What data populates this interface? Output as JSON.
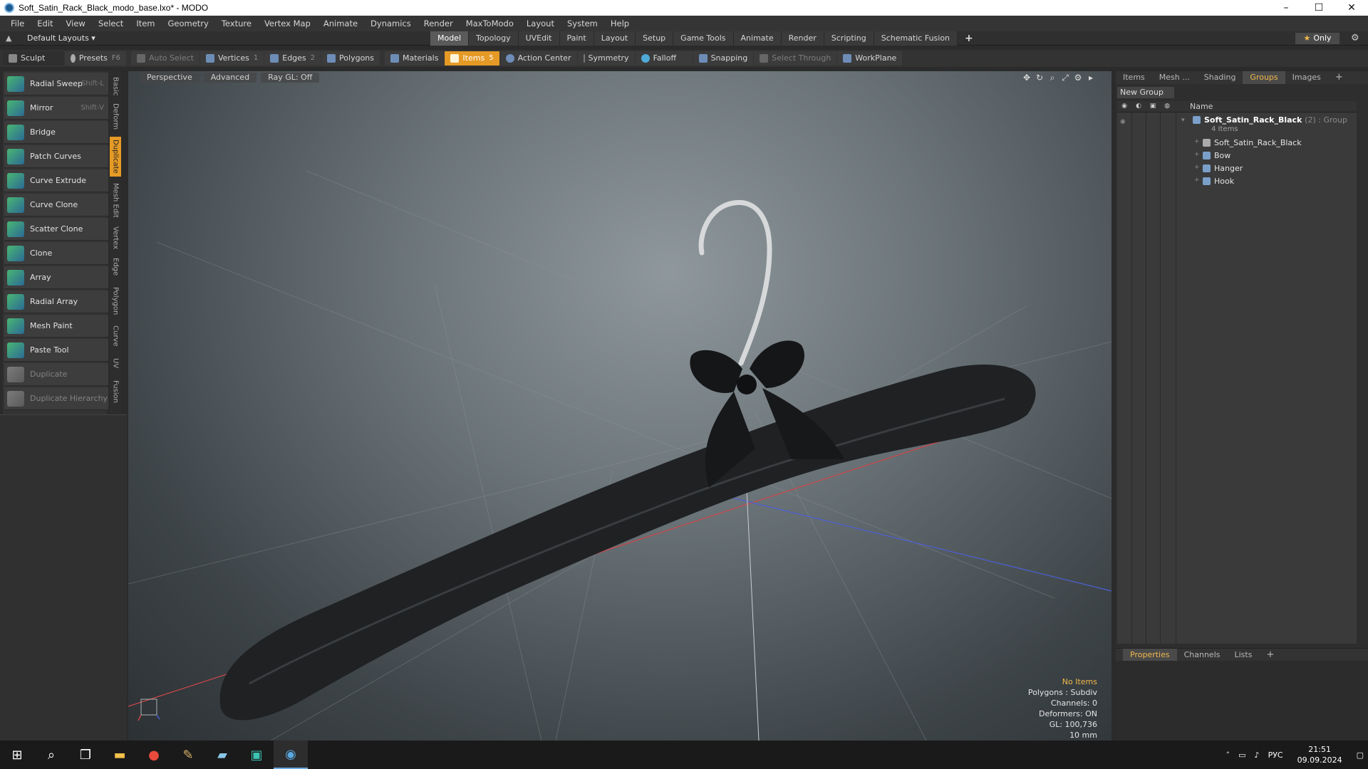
{
  "window": {
    "title": "Soft_Satin_Rack_Black_modo_base.lxo* - MODO",
    "minimize": "–",
    "maximize": "☐",
    "close": "✕"
  },
  "menu": [
    "File",
    "Edit",
    "View",
    "Select",
    "Item",
    "Geometry",
    "Texture",
    "Vertex Map",
    "Animate",
    "Dynamics",
    "Render",
    "MaxToModo",
    "Layout",
    "System",
    "Help"
  ],
  "layoutbar": {
    "default_layouts": "Default Layouts ▾",
    "tabs": [
      "Model",
      "Topology",
      "UVEdit",
      "Paint",
      "Layout",
      "Setup",
      "Game Tools",
      "Animate",
      "Render",
      "Scripting",
      "Schematic Fusion"
    ],
    "active_tab": "Model",
    "add": "+",
    "only": "Only",
    "star": "★",
    "gear": "⚙"
  },
  "toolbar": {
    "sculpt": "Sculpt",
    "presets": "Presets",
    "presets_key": "F6",
    "auto_select": "Auto Select",
    "vertices": "Vertices",
    "vertices_count": "1",
    "edges": "Edges",
    "edges_count": "2",
    "polygons": "Polygons",
    "materials": "Materials",
    "items": "Items",
    "items_count": "5",
    "action_center": "Action Center",
    "symmetry": "Symmetry",
    "falloff": "Falloff",
    "snapping": "Snapping",
    "select_through": "Select Through",
    "workplane": "WorkPlane"
  },
  "tools": [
    {
      "label": "Radial Sweep",
      "key": "Shift-L",
      "enabled": true
    },
    {
      "label": "Mirror",
      "key": "Shift-V",
      "enabled": true
    },
    {
      "label": "Bridge",
      "key": "",
      "enabled": true
    },
    {
      "label": "Patch Curves",
      "key": "",
      "enabled": true
    },
    {
      "label": "Curve Extrude",
      "key": "",
      "enabled": true
    },
    {
      "label": "Curve Clone",
      "key": "",
      "enabled": true
    },
    {
      "label": "Scatter Clone",
      "key": "",
      "enabled": true
    },
    {
      "label": "Clone",
      "key": "",
      "enabled": true
    },
    {
      "label": "Array",
      "key": "",
      "enabled": true
    },
    {
      "label": "Radial Array",
      "key": "",
      "enabled": true
    },
    {
      "label": "Mesh Paint",
      "key": "",
      "enabled": true
    },
    {
      "label": "Paste Tool",
      "key": "",
      "enabled": true
    },
    {
      "label": "Duplicate",
      "key": "",
      "enabled": false
    },
    {
      "label": "Duplicate Hierarchy",
      "key": "",
      "enabled": false
    }
  ],
  "side_tabs": [
    "Basic",
    "Deform",
    "Duplicate",
    "Mesh Edit",
    "Vertex",
    "Edge",
    "Polygon",
    "Curve",
    "UV",
    "Fusion"
  ],
  "active_side_tab": "Duplicate",
  "viewport": {
    "tabs": [
      "Perspective",
      "Advanced",
      "Ray GL: Off"
    ],
    "icons": [
      "move-icon",
      "rotate-icon",
      "zoom-icon",
      "fit-icon",
      "settings-icon",
      "expand-icon"
    ],
    "info": {
      "no_items": "No Items",
      "polygons": "Polygons : Subdiv",
      "channels": "Channels: 0",
      "deformers": "Deformers: ON",
      "gl": "GL: 100,736",
      "scale": "10 mm"
    }
  },
  "right_panel": {
    "tabs": [
      "Items",
      "Mesh ...",
      "Shading",
      "Groups",
      "Images"
    ],
    "active_tab": "Groups",
    "add": "+",
    "new_group": "New Group",
    "name_header": "Name",
    "group": {
      "name": "Soft_Satin_Rack_Black",
      "suffix": "(2) : Group",
      "count": "4 Items"
    },
    "children": [
      "Soft_Satin_Rack_Black",
      "Bow",
      "Hanger",
      "Hook"
    ],
    "bottom_tabs": [
      "Properties",
      "Channels",
      "Lists"
    ],
    "bottom_active": "Properties",
    "bottom_add": "+"
  },
  "taskbar": {
    "lang": "РУС",
    "time": "21:51",
    "date": "09.09.2024"
  },
  "colors": {
    "accent": "#e59a26",
    "selected_text": "#f2b84b",
    "x_axis": "#d0464a",
    "z_axis": "#4d5fd6"
  }
}
